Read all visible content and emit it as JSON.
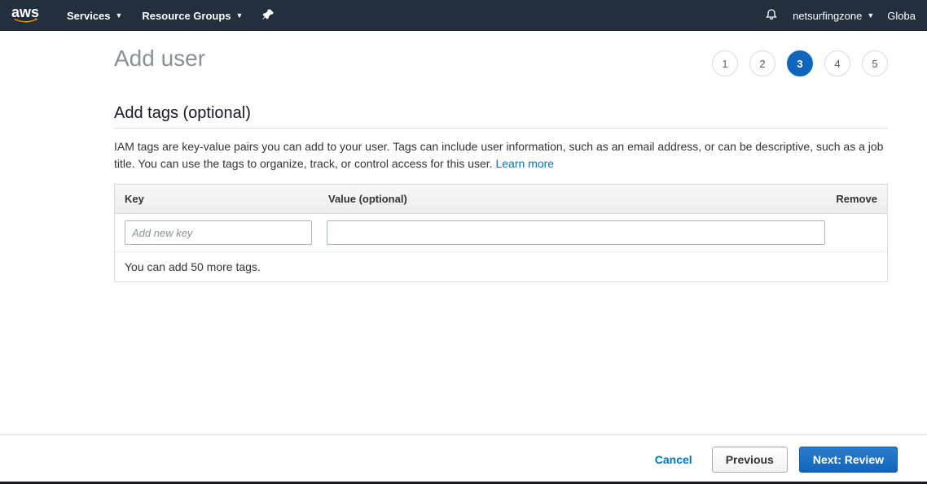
{
  "nav": {
    "logo": "aws",
    "services": "Services",
    "resource_groups": "Resource Groups",
    "account": "netsurfingzone",
    "region": "Globa"
  },
  "page": {
    "title": "Add user",
    "steps": [
      "1",
      "2",
      "3",
      "4",
      "5"
    ],
    "active_step": 3
  },
  "section": {
    "title": "Add tags (optional)",
    "description_a": "IAM tags are key-value pairs you can add to your user. Tags can include user information, such as an email address, or can be descriptive, such as a job title. You can use the tags to organize, track, or control access for this user. ",
    "learn_more": "Learn more"
  },
  "table": {
    "col_key": "Key",
    "col_value": "Value (optional)",
    "col_remove": "Remove",
    "key_placeholder": "Add new key",
    "counter": "You can add 50 more tags."
  },
  "footer": {
    "cancel": "Cancel",
    "previous": "Previous",
    "next": "Next: Review"
  }
}
